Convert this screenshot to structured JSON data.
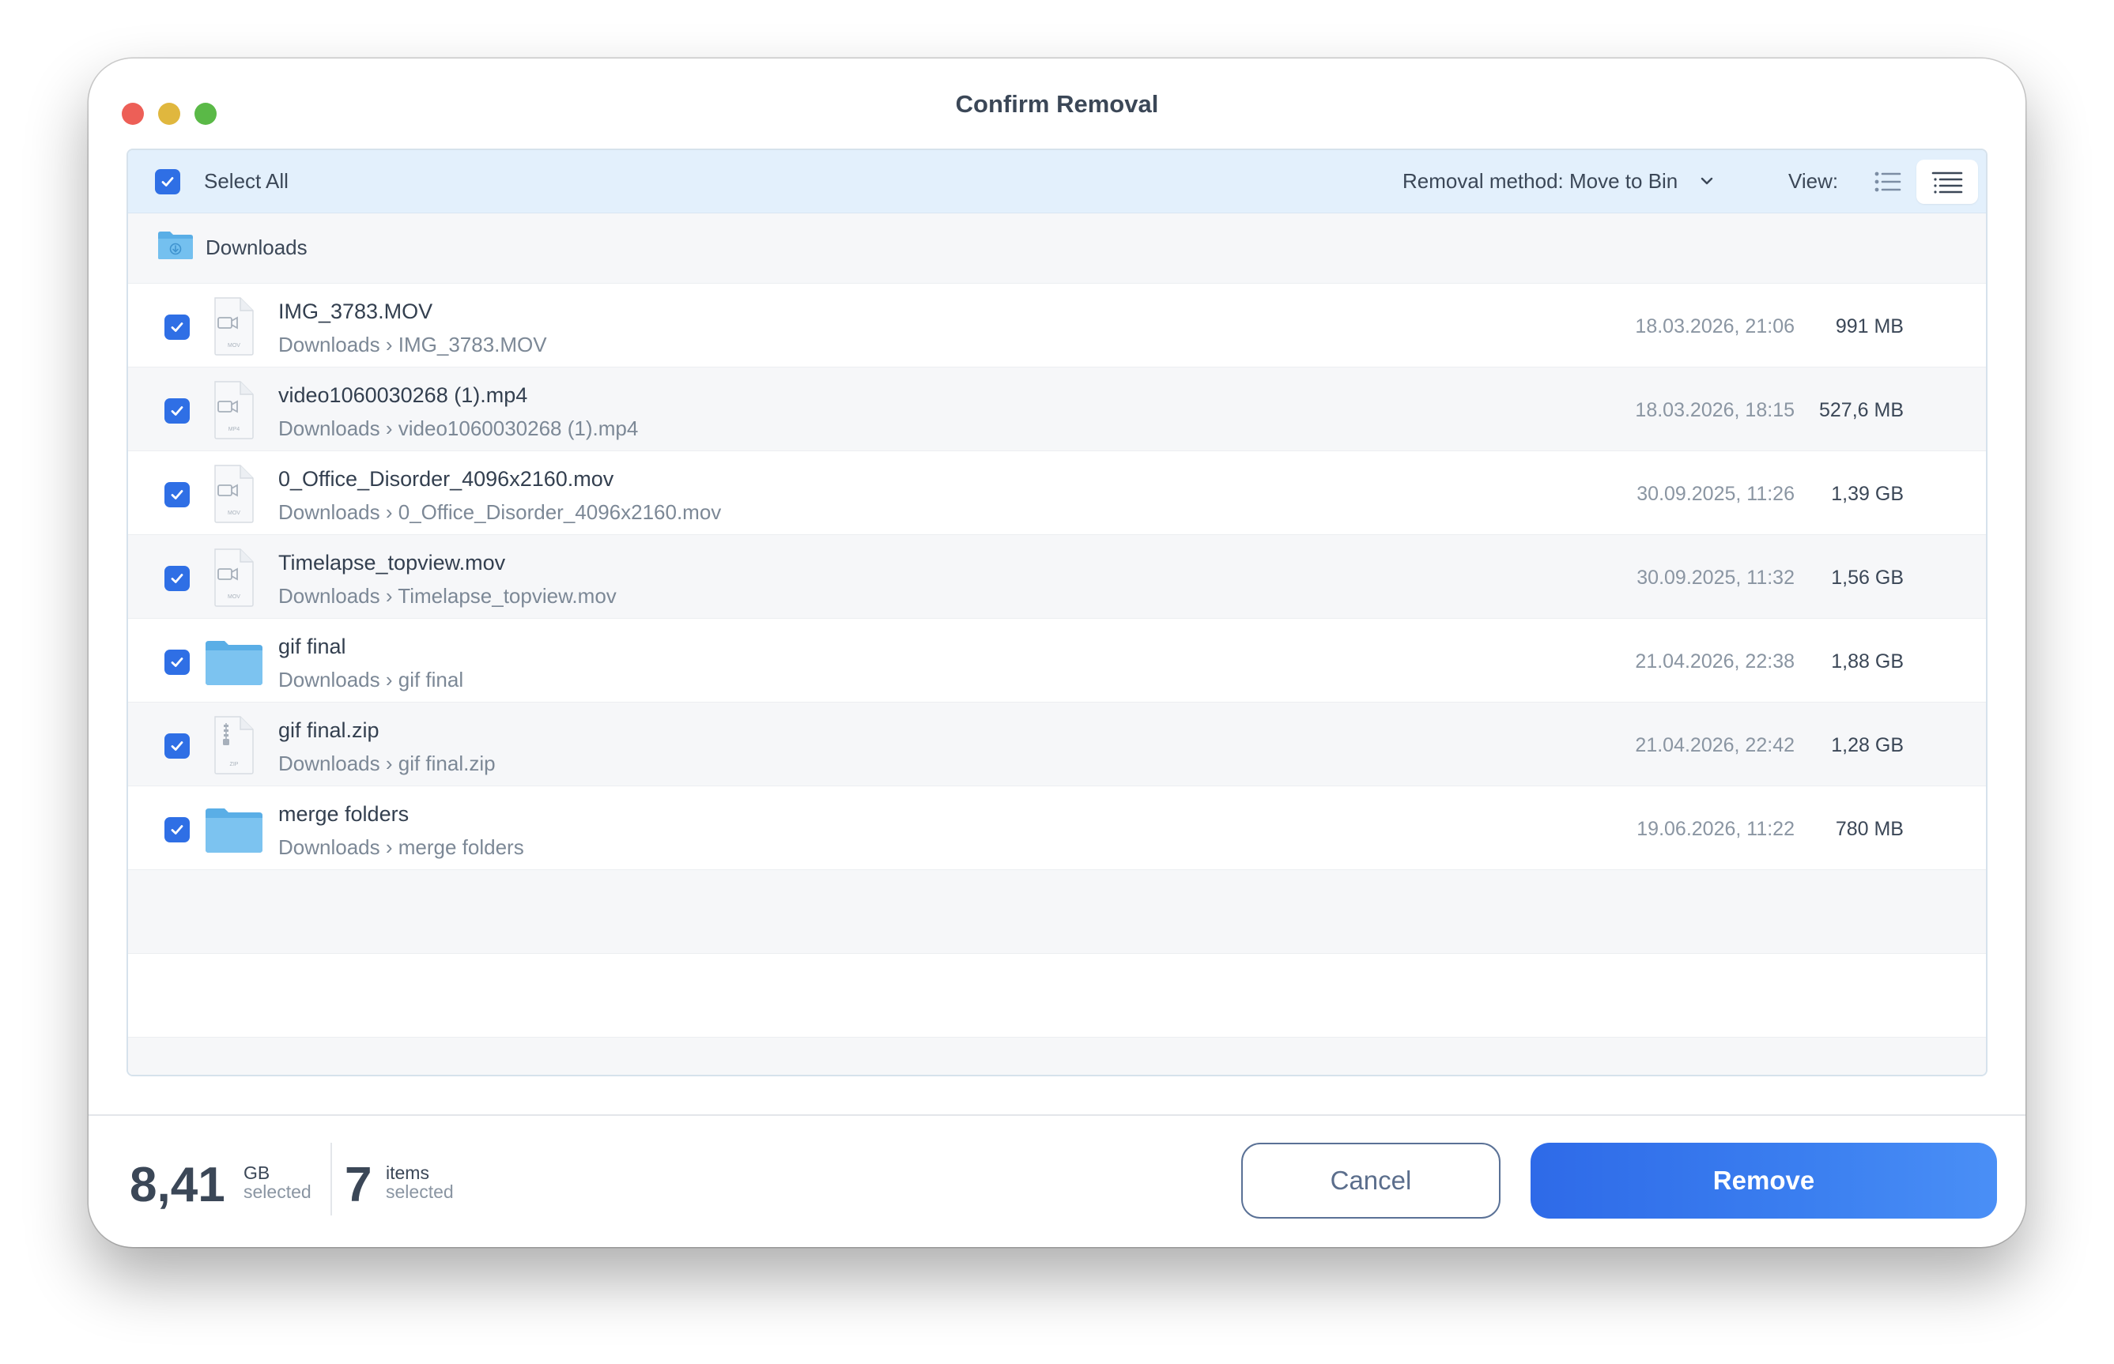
{
  "window": {
    "title": "Confirm Removal"
  },
  "toolbar": {
    "select_all_label": "Select All",
    "removal_method_label": "Removal method: Move to Bin",
    "view_label": "View:"
  },
  "group": {
    "label": "Downloads"
  },
  "files": [
    {
      "name": "IMG_3783.MOV",
      "path_root": "Downloads",
      "path_leaf": "IMG_3783.MOV",
      "date": "18.03.2026, 21:06",
      "size": "991 MB",
      "icon": "video-file-icon",
      "ext": "MOV",
      "checked": true
    },
    {
      "name": "video1060030268 (1).mp4",
      "path_root": "Downloads",
      "path_leaf": "video1060030268 (1).mp4",
      "date": "18.03.2026, 18:15",
      "size": "527,6 MB",
      "icon": "video-file-icon",
      "ext": "MP4",
      "checked": true
    },
    {
      "name": "0_Office_Disorder_4096x2160.mov",
      "path_root": "Downloads",
      "path_leaf": "0_Office_Disorder_4096x2160.mov",
      "date": "30.09.2025, 11:26",
      "size": "1,39 GB",
      "icon": "video-file-icon",
      "ext": "MOV",
      "checked": true
    },
    {
      "name": "Timelapse_topview.mov",
      "path_root": "Downloads",
      "path_leaf": "Timelapse_topview.mov",
      "date": "30.09.2025, 11:32",
      "size": "1,56 GB",
      "icon": "video-file-icon",
      "ext": "MOV",
      "checked": true
    },
    {
      "name": "gif final",
      "path_root": "Downloads",
      "path_leaf": "gif final",
      "date": "21.04.2026, 22:38",
      "size": "1,88 GB",
      "icon": "folder-icon",
      "ext": "",
      "checked": true
    },
    {
      "name": "gif final.zip",
      "path_root": "Downloads",
      "path_leaf": "gif final.zip",
      "date": "21.04.2026, 22:42",
      "size": "1,28 GB",
      "icon": "zip-file-icon",
      "ext": "ZIP",
      "checked": true
    },
    {
      "name": "merge folders",
      "path_root": "Downloads",
      "path_leaf": "merge folders",
      "date": "19.06.2026, 11:22",
      "size": "780 MB",
      "icon": "folder-icon",
      "ext": "",
      "checked": true
    }
  ],
  "footer": {
    "size_value": "8,41",
    "size_unit": "GB",
    "size_sub": "selected",
    "count_value": "7",
    "count_unit": "items",
    "count_sub": "selected",
    "cancel_label": "Cancel",
    "remove_label": "Remove"
  },
  "colors": {
    "accent": "#2f6fe5",
    "toolbar_bg": "#e3f0fc",
    "folder": "#5aaee6"
  }
}
